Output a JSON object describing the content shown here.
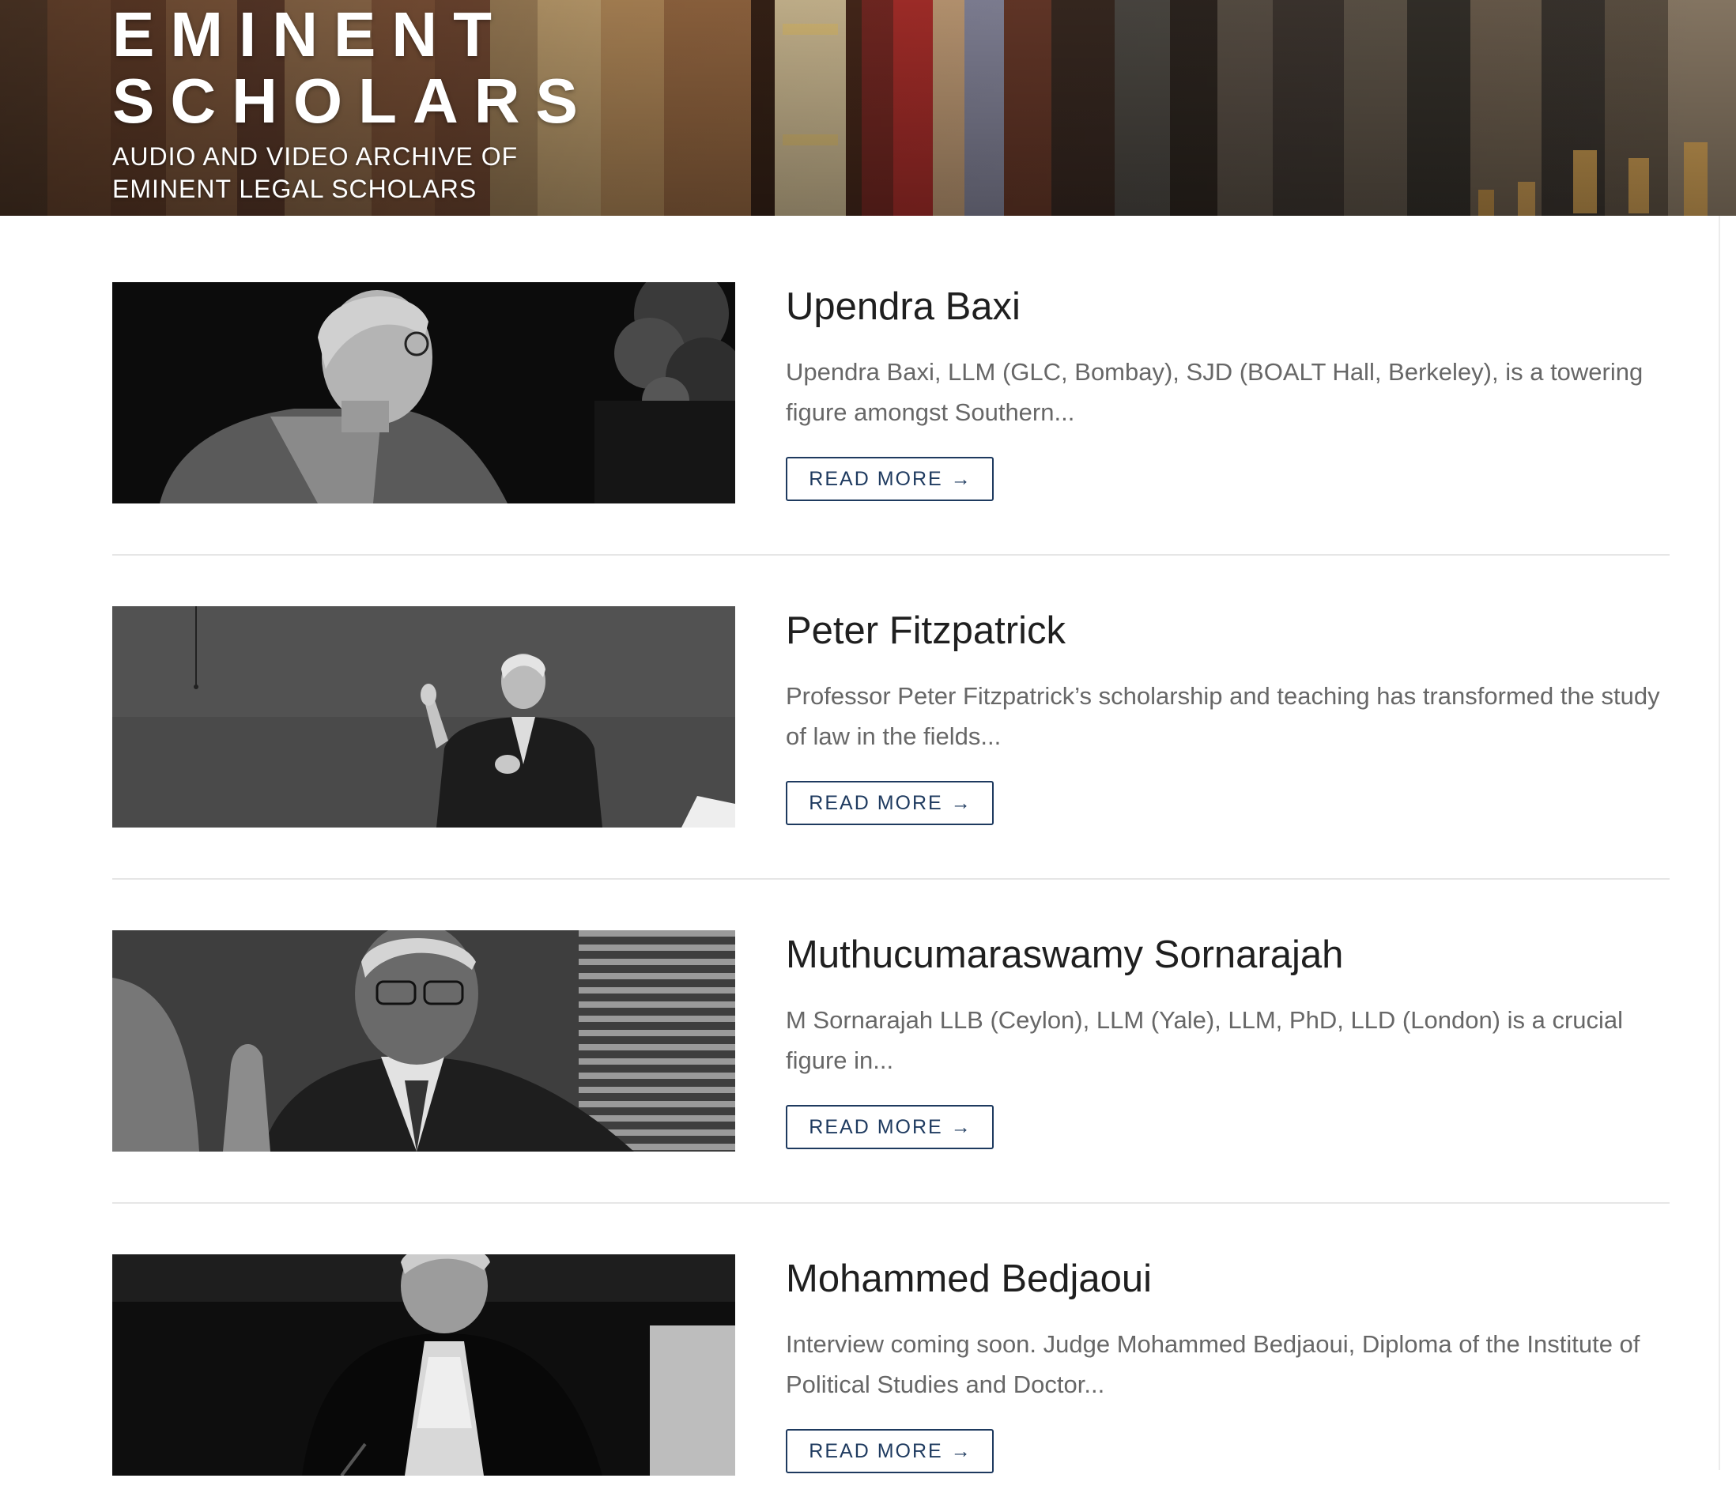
{
  "hero": {
    "title_line1": "EMINENT",
    "title_line2": "SCHOLARS",
    "subtitle": "AUDIO AND VIDEO ARCHIVE OF EMINENT LEGAL SCHOLARS"
  },
  "scholars": [
    {
      "name": "Upendra Baxi",
      "excerpt": "Upendra Baxi, LLM (GLC, Bombay), SJD (BOALT Hall, Berkeley), is a towering figure amongst Southern...",
      "read_more_label": "READ MORE",
      "arrow_icon": "arrow-right-icon"
    },
    {
      "name": "Peter Fitzpatrick",
      "excerpt": "Professor Peter Fitzpatrick’s scholarship and teaching has transformed the study of law in the fields...",
      "read_more_label": "READ MORE",
      "arrow_icon": "arrow-right-icon"
    },
    {
      "name": "Muthucumaraswamy Sornarajah",
      "excerpt": "M Sornarajah LLB (Ceylon), LLM (Yale), LLM, PhD, LLD (London) is a crucial figure in...",
      "read_more_label": "READ MORE",
      "arrow_icon": "arrow-right-icon"
    },
    {
      "name": "Mohammed Bedjaoui",
      "excerpt": "Interview coming soon. Judge Mohammed Bedjaoui, Diploma of the Institute of Political Studies and Doctor...",
      "read_more_label": "READ MORE",
      "arrow_icon": "arrow-right-icon"
    }
  ],
  "colors": {
    "accent": "#1e3a5f",
    "heading": "#1f1f1f",
    "body_text": "#676767",
    "divider": "#e6e6e6"
  }
}
